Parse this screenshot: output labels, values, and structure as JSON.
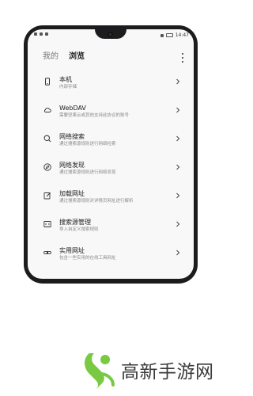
{
  "statusbar": {
    "time": "14:47"
  },
  "header": {
    "tab_mine": "我的",
    "tab_browse": "浏览"
  },
  "items": [
    {
      "title": "本机",
      "subtitle": "内部存储",
      "icon": "phone-icon"
    },
    {
      "title": "WebDAV",
      "subtitle": "需要坚果云或其他支持此协议的账号",
      "icon": "cloud-icon"
    },
    {
      "title": "网络搜索",
      "subtitle": "通过搜索源规则进行网络检索",
      "icon": "search-icon"
    },
    {
      "title": "网络发现",
      "subtitle": "通过搜索源规则进行网络发现",
      "icon": "compass-icon"
    },
    {
      "title": "加载网址",
      "subtitle": "通过搜索源规则对详情页网址进行解析",
      "icon": "edit-link-icon"
    },
    {
      "title": "搜索源管理",
      "subtitle": "导入自定义搜索规则",
      "icon": "code-box-icon"
    },
    {
      "title": "实用网址",
      "subtitle": "包含一些实用的在线工具网址",
      "icon": "link-icon"
    }
  ],
  "watermark": {
    "text": "高新手游网",
    "accent": "#7ac943"
  },
  "colors": {
    "screen_bg": "#f8f8f8",
    "frame": "#1c1c1e",
    "title": "#222222",
    "subtitle": "#8a8a8a"
  }
}
